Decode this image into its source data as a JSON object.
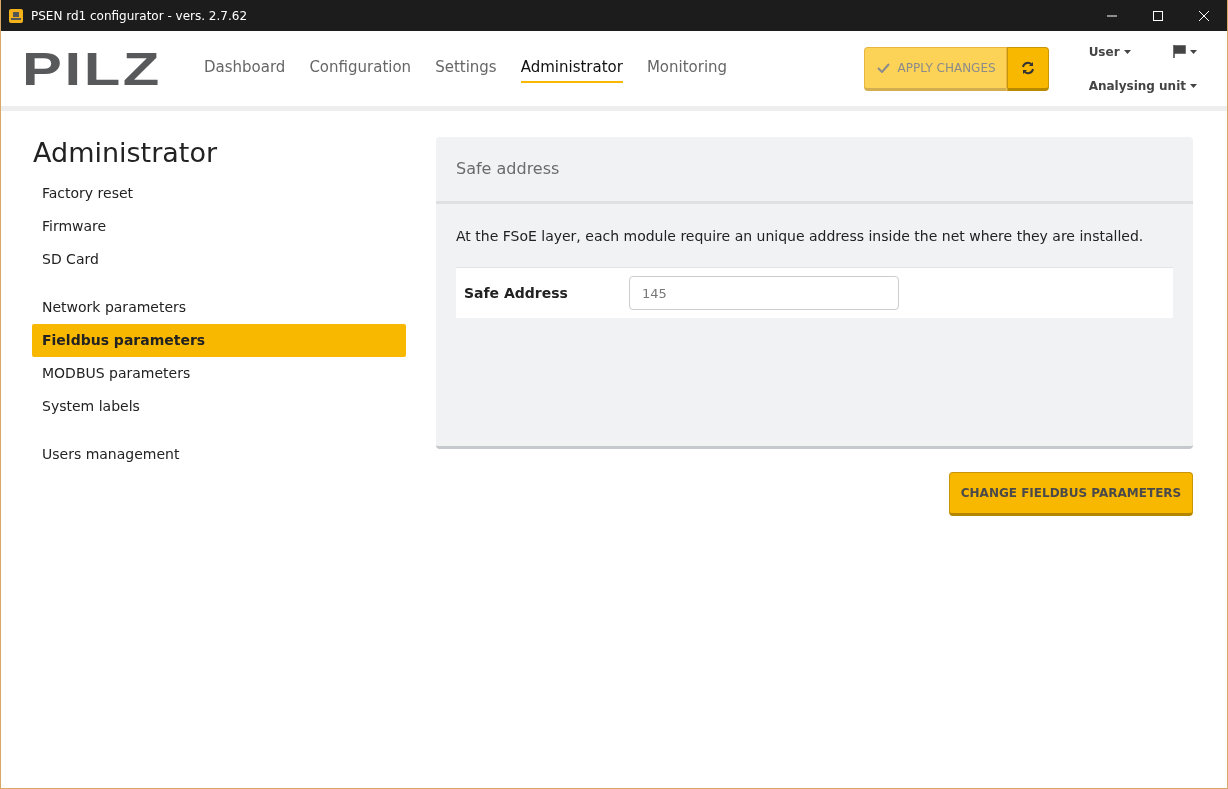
{
  "window": {
    "title": "PSEN rd1 configurator - vers. 2.7.62"
  },
  "logo": "PILZ",
  "nav": [
    {
      "label": "Dashboard",
      "selected": false
    },
    {
      "label": "Configuration",
      "selected": false
    },
    {
      "label": "Settings",
      "selected": false
    },
    {
      "label": "Administrator",
      "selected": true
    },
    {
      "label": "Monitoring",
      "selected": false
    }
  ],
  "apply_button": {
    "label": "APPLY CHANGES",
    "disabled": true
  },
  "menus": {
    "user": "User",
    "unit": "Analysing unit"
  },
  "sidebar": {
    "title": "Administrator",
    "groups": [
      [
        {
          "label": "Factory reset",
          "selected": false
        },
        {
          "label": "Firmware",
          "selected": false
        },
        {
          "label": "SD Card",
          "selected": false
        }
      ],
      [
        {
          "label": "Network parameters",
          "selected": false
        },
        {
          "label": "Fieldbus parameters",
          "selected": true
        },
        {
          "label": "MODBUS parameters",
          "selected": false
        },
        {
          "label": "System labels",
          "selected": false
        }
      ],
      [
        {
          "label": "Users management",
          "selected": false
        }
      ]
    ]
  },
  "panel": {
    "title": "Safe address",
    "description": "At the FSoE layer, each module require an unique address inside the net where they are installed.",
    "field": {
      "label": "Safe Address",
      "value": "145"
    }
  },
  "submit_button": "CHANGE FIELDBUS PARAMETERS"
}
